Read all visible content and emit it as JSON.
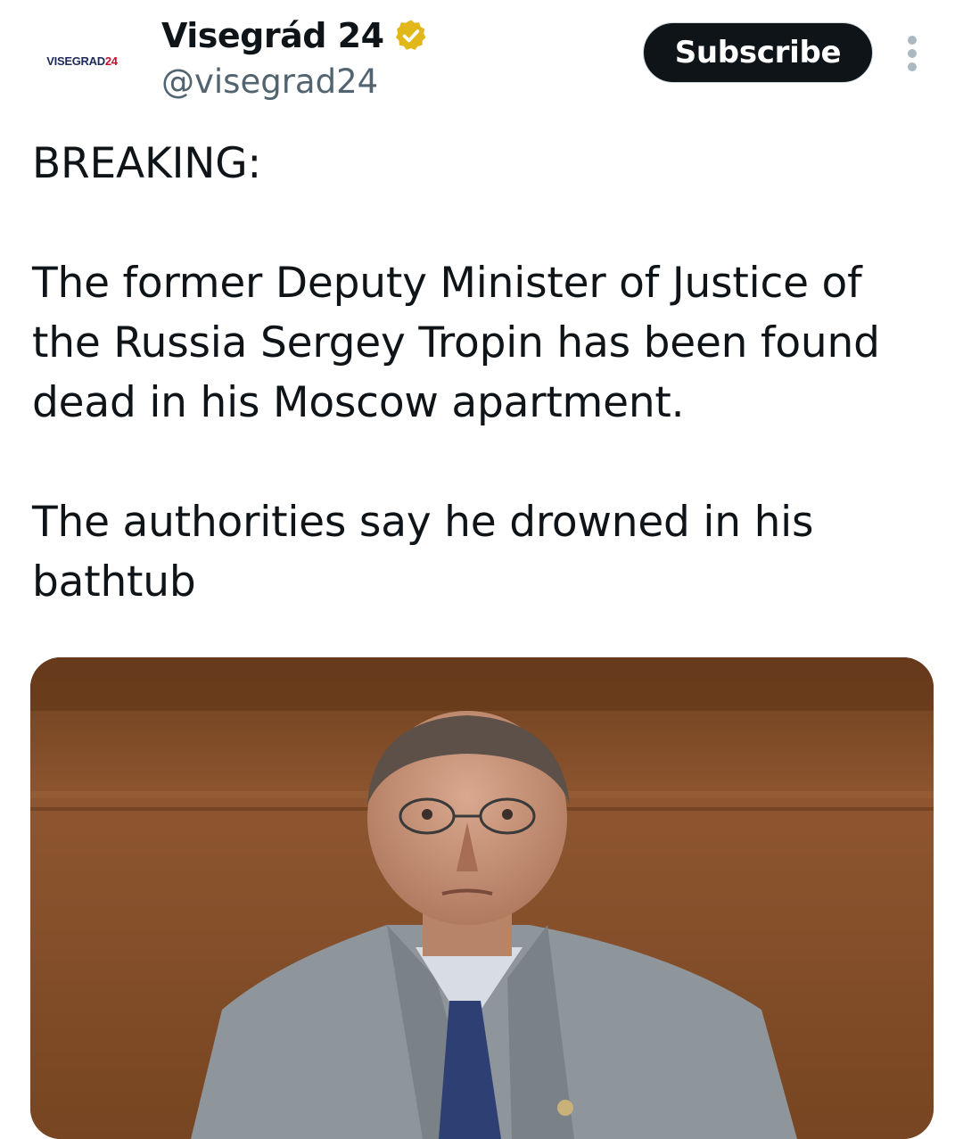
{
  "account": {
    "avatar_text_part1": "VISEGRAD",
    "avatar_text_part2": "24",
    "display_name": "Visegrád 24",
    "handle": "@visegrad24",
    "verified_icon": "gold-verified-badge-icon"
  },
  "actions": {
    "subscribe_label": "Subscribe",
    "more_icon": "vertical-ellipsis-icon"
  },
  "tweet": {
    "paragraphs": [
      "BREAKING:",
      "The former Deputy Minister of Justice of the Russia Sergey Tropin has been found dead in his Moscow apartment.",
      "The authorities say he drowned in his bathtub"
    ]
  },
  "colors": {
    "text": "#0f1419",
    "secondary_text": "#536471",
    "button_bg": "#0f1419",
    "badge_gold": "#e2b719",
    "logo_blue": "#1c2b5a",
    "logo_red": "#c8102e"
  }
}
